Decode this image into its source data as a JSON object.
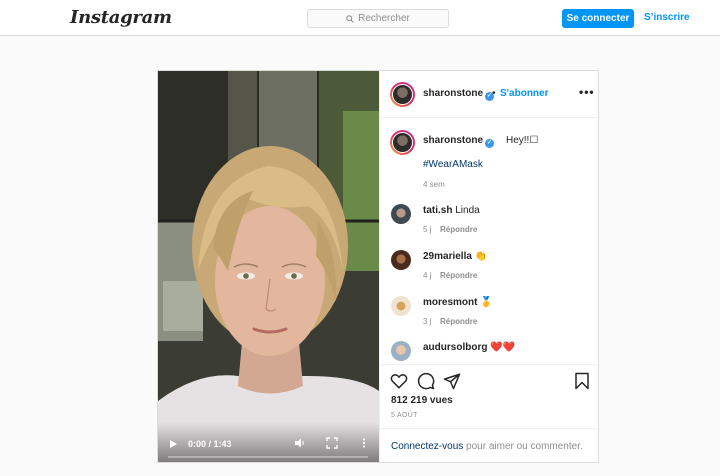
{
  "header": {
    "logo": "Instagram",
    "search_placeholder": "Rechercher",
    "login_label": "Se connecter",
    "signup_label": "S’inscrire"
  },
  "post": {
    "author": "sharonstone",
    "follow_label": "S'abonner",
    "separator": "•",
    "more_label": "•••",
    "video": {
      "timecode": "0:00 / 1:43",
      "progress": 0
    },
    "caption": {
      "username": "sharonstone",
      "text": "Hey!!☐",
      "hashtag": "#WearAMask",
      "age": "4 sem"
    },
    "comments": [
      {
        "username": "tati.sh",
        "text": "Linda",
        "age": "5 j",
        "reply": "Répondre"
      },
      {
        "username": "29mariella",
        "text": "👏",
        "age": "4 j",
        "reply": "Répondre"
      },
      {
        "username": "moresmont",
        "text": "🥇",
        "age": "3 j",
        "reply": "Répondre"
      },
      {
        "username": "audursolborg",
        "text": "❤️❤️",
        "age": "",
        "reply": ""
      }
    ],
    "likes": "812 219 vues",
    "date": "5 AOÛT",
    "login_prompt_link": "Connectez-vous",
    "login_prompt_rest": " pour aimer ou commenter."
  },
  "colors": {
    "accent": "#0095f6",
    "verified": "#3897f0",
    "hashtag": "#00376b",
    "muted": "#8e8e8e"
  },
  "icons": [
    "search-icon",
    "verified-icon",
    "more-icon",
    "play-icon",
    "volume-icon",
    "fullscreen-icon",
    "video-menu-icon",
    "heart-icon",
    "comment-icon",
    "share-icon",
    "bookmark-icon"
  ]
}
